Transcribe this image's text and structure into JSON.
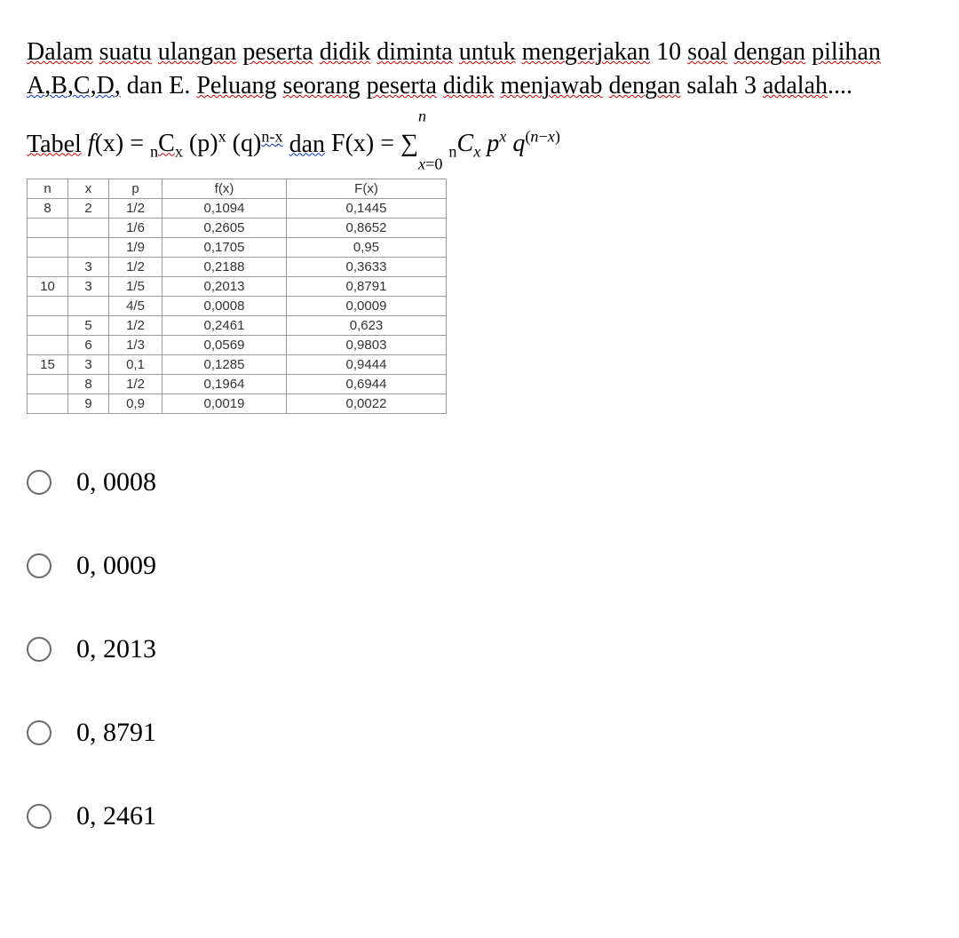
{
  "question": {
    "t1": "Dalam",
    "t2": "suatu",
    "t3": "ulangan",
    "t4": "peserta",
    "t5": "didik",
    "t6": "diminta",
    "t7": "untuk",
    "t8": "mengerjakan",
    "t9": "10",
    "t10": "soal",
    "t11": "dengan",
    "t12": "pilihan",
    "t13": "A,B,C,D,",
    "t14": "dan E.",
    "t15": "Peluang",
    "t16": "seorang",
    "t17": "peserta",
    "t18": "didik",
    "t19": "menjawab",
    "t20": "dengan",
    "t21": "salah 3",
    "t22": "adalah",
    "t23": "...."
  },
  "formula": {
    "lead": "Tabel",
    "mid": "dan"
  },
  "table": {
    "head": {
      "n": "n",
      "x": "x",
      "p": "p",
      "fx": "f(x)",
      "Fx": "F(x)"
    },
    "rows": [
      {
        "n": "8",
        "x": "2",
        "p": "1/2",
        "fx": "0,1094",
        "Fx": "0,1445"
      },
      {
        "n": "",
        "x": "",
        "p": "1/6",
        "fx": "0,2605",
        "Fx": "0,8652"
      },
      {
        "n": "",
        "x": "",
        "p": "1/9",
        "fx": "0,1705",
        "Fx": "0,95"
      },
      {
        "n": "",
        "x": "3",
        "p": "1/2",
        "fx": "0,2188",
        "Fx": "0,3633"
      },
      {
        "n": "10",
        "x": "3",
        "p": "1/5",
        "fx": "0,2013",
        "Fx": "0,8791"
      },
      {
        "n": "",
        "x": "",
        "p": "4/5",
        "fx": "0,0008",
        "Fx": "0,0009"
      },
      {
        "n": "",
        "x": "5",
        "p": "1/2",
        "fx": "0,2461",
        "Fx": "0,623"
      },
      {
        "n": "",
        "x": "6",
        "p": "1/3",
        "fx": "0,0569",
        "Fx": "0,9803"
      },
      {
        "n": "15",
        "x": "3",
        "p": "0,1",
        "fx": "0,1285",
        "Fx": "0,9444"
      },
      {
        "n": "",
        "x": "8",
        "p": "1/2",
        "fx": "0,1964",
        "Fx": "0,6944"
      },
      {
        "n": "",
        "x": "9",
        "p": "0,9",
        "fx": "0,0019",
        "Fx": "0,0022"
      }
    ]
  },
  "options": [
    "0, 0008",
    "0, 0009",
    "0, 2013",
    "0, 8791",
    "0, 2461"
  ]
}
